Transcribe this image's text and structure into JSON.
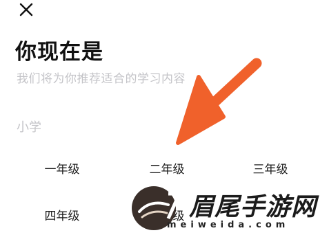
{
  "header": {
    "title": "你现在是",
    "subtitle": "我们将为你推荐适合的学习内容"
  },
  "section": {
    "label": "小学",
    "grades": [
      "一年级",
      "二年级",
      "三年级",
      "四年级",
      "五年级"
    ]
  },
  "watermark": {
    "text": "眉尾手游网",
    "sub": "meiweida.com"
  },
  "colors": {
    "arrow": "#f0612b",
    "title": "#111111",
    "muted": "#c4c4c8"
  }
}
